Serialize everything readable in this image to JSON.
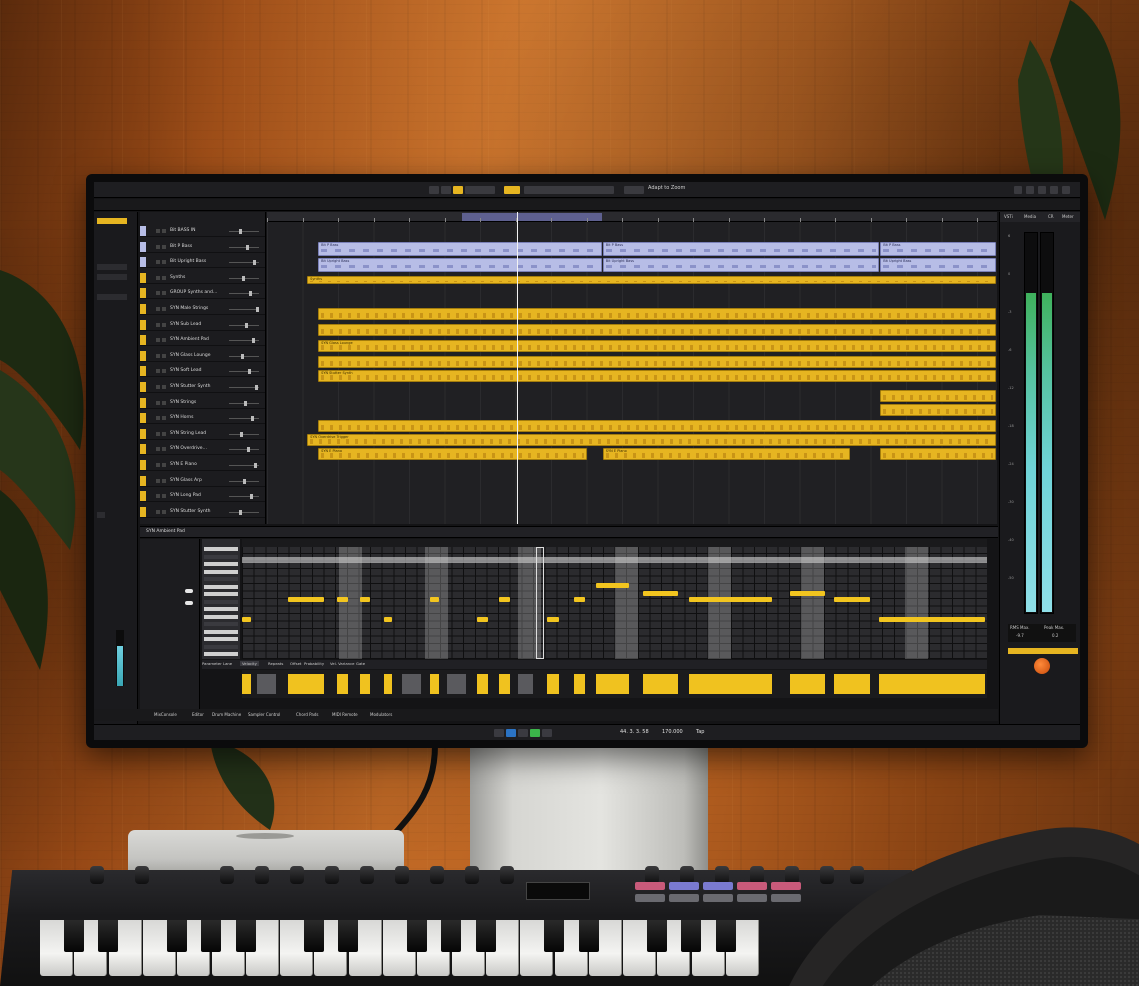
{
  "scene": {
    "description_tags": [
      "wood-wall",
      "plant",
      "monitor",
      "daw-software",
      "mac-mini",
      "midi-keyboard",
      "office-chair"
    ],
    "colors": {
      "wall": "#b45f20",
      "clip_yellow": "#e6b521",
      "clip_lavender": "#b7bde6",
      "meter_green": "#3fb15c",
      "meter_cyan": "#8fdfe8",
      "play_green": "#3bb54a",
      "knob_orange": "#ff8a3a"
    }
  },
  "daw": {
    "toolbar": {
      "zoom_label": "Adapt to Zoom"
    },
    "tracks": [
      {
        "num": "",
        "name": "Bit BASS IN",
        "color": "#b7bde6"
      },
      {
        "num": "",
        "name": "Bit P Bass",
        "color": "#b7bde6"
      },
      {
        "num": "",
        "name": "Bit Upright Bass",
        "color": "#b7bde6"
      },
      {
        "num": "",
        "name": "Synths",
        "color": "#e6b521"
      },
      {
        "num": "",
        "name": "GROUP Synths and…",
        "color": "#e6b521"
      },
      {
        "num": "",
        "name": "SYN Male Strings",
        "color": "#e6b521"
      },
      {
        "num": "",
        "name": "SYN Sub Lead",
        "color": "#e6b521"
      },
      {
        "num": "",
        "name": "SYN Ambient Pad",
        "color": "#e6b521"
      },
      {
        "num": "",
        "name": "SYN Glass Lounge",
        "color": "#e6b521"
      },
      {
        "num": "",
        "name": "SYN Soft Lead",
        "color": "#e6b521"
      },
      {
        "num": "",
        "name": "SYN Stutter Synth",
        "color": "#e6b521"
      },
      {
        "num": "",
        "name": "SYN Strings",
        "color": "#e6b521"
      },
      {
        "num": "",
        "name": "SYN Horns",
        "color": "#e6b521"
      },
      {
        "num": "",
        "name": "SYN String Lead",
        "color": "#e6b521"
      },
      {
        "num": "",
        "name": "SYN Overdrive…",
        "color": "#e6b521"
      },
      {
        "num": "",
        "name": "SYN E Piano",
        "color": "#e6b521"
      },
      {
        "num": "",
        "name": "SYN Glass Arp",
        "color": "#e6b521"
      },
      {
        "num": "",
        "name": "SYN Long Pad",
        "color": "#e6b521"
      },
      {
        "num": "",
        "name": "SYN Stutter Synth",
        "color": "#e6b521"
      }
    ],
    "clips": [
      {
        "name": "Bit P Bass",
        "kind": "bass"
      },
      {
        "name": "Bit P Bass",
        "kind": "bass"
      },
      {
        "name": "Bit P Bass",
        "kind": "bass"
      },
      {
        "name": "Bit Upright Bass",
        "kind": "bass"
      },
      {
        "name": "Bit Upright Bass",
        "kind": "bass"
      },
      {
        "name": "Bit Upright Bass",
        "kind": "bass"
      },
      {
        "name": "Synths",
        "kind": "synth"
      },
      {
        "name": "SYN Glass Lounge",
        "kind": "synth"
      },
      {
        "name": "SYN Stutter Synth",
        "kind": "synth"
      },
      {
        "name": "SYN Overdrive Trigger",
        "kind": "synth"
      },
      {
        "name": "SYN E Piano",
        "kind": "synth"
      },
      {
        "name": "SYN E Piano",
        "kind": "synth"
      }
    ],
    "right_panel": {
      "tabs": [
        "VSTi",
        "Media",
        "CR",
        "Meter"
      ],
      "peak_labels": [
        "RMS Max.",
        "Peak Max."
      ],
      "peak_values": [
        "-9.7",
        "0.2"
      ],
      "scale": [
        "6",
        "0",
        "-3",
        "-6",
        "-12",
        "-18",
        "-24",
        "-30",
        "-40",
        "-50"
      ]
    },
    "editor": {
      "title": "SYN Ambient Pad"
    },
    "param_lane_tabs": [
      "Parameter Lane",
      "Velocity",
      "Repeats",
      "Offset",
      "Probability",
      "Vel. Variance",
      "Gate"
    ],
    "bottom_tabs": [
      "MixConsole",
      "Editor",
      "Drum Machine",
      "Sampler Control",
      "Chord Pads",
      "MIDI Remote",
      "Modulators"
    ],
    "transport": {
      "position": "44. 3. 3. 58",
      "tempo": "170.000",
      "tap": "Tap"
    }
  }
}
